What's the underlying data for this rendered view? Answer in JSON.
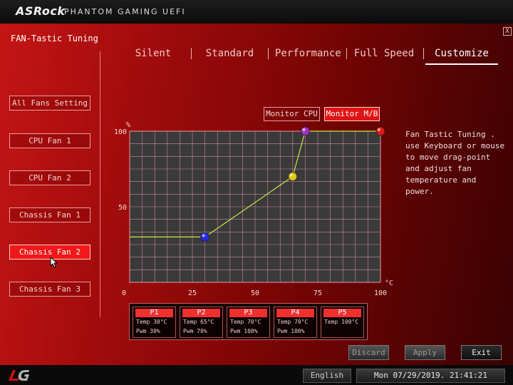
{
  "header": {
    "brand": "ASRock",
    "product": "PHANTOM GAMING UEFI"
  },
  "window": {
    "title": "FAN-Tastic Tuning",
    "close_label": "X"
  },
  "tabs": [
    {
      "label": "Silent",
      "active": false
    },
    {
      "label": "Standard",
      "active": false
    },
    {
      "label": "Performance",
      "active": false
    },
    {
      "label": "Full Speed",
      "active": false
    },
    {
      "label": "Customize",
      "active": true
    }
  ],
  "sidebar": {
    "items": [
      {
        "label": "All Fans Setting",
        "active": false
      },
      {
        "label": "CPU Fan 1",
        "active": false
      },
      {
        "label": "CPU Fan 2",
        "active": false
      },
      {
        "label": "Chassis Fan 1",
        "active": false
      },
      {
        "label": "Chassis Fan 2",
        "active": true
      },
      {
        "label": "Chassis Fan 3",
        "active": false
      }
    ]
  },
  "monitor": {
    "cpu_label": "Monitor CPU",
    "mb_label": "Monitor M/B",
    "selected": "Monitor M/B"
  },
  "help_text": "Fan Tastic Tuning . use Keyboard or mouse to move drag-point and adjust fan temperature and power.",
  "chart_data": {
    "type": "line",
    "xlabel": "°C",
    "ylabel": "%",
    "xlim": [
      0,
      100
    ],
    "ylim": [
      0,
      100
    ],
    "x_ticks": [
      "0",
      "25",
      "50",
      "75",
      "100"
    ],
    "y_ticks": [
      "50",
      "100"
    ],
    "grid": true,
    "series": [
      {
        "points": [
          {
            "x": 0,
            "y": 30
          },
          {
            "x": 30,
            "y": 30
          },
          {
            "x": 65,
            "y": 70
          },
          {
            "x": 70,
            "y": 100
          },
          {
            "x": 100,
            "y": 100
          }
        ]
      }
    ],
    "control_points": [
      {
        "x": 30,
        "y": 30,
        "color": "#2a2ae8"
      },
      {
        "x": 65,
        "y": 70,
        "color": "#e0c818"
      },
      {
        "x": 70,
        "y": 100,
        "color": "#a030c8"
      },
      {
        "x": 100,
        "y": 100,
        "color": "#e01818"
      }
    ],
    "colors": {
      "line": "#c8e848",
      "grid": "#e89aa8",
      "plot_bg": "#3a3a3a"
    }
  },
  "points": [
    {
      "name": "P1",
      "temp": "Temp 30°C",
      "pwm": "Pwm  30%"
    },
    {
      "name": "P2",
      "temp": "Temp 65°C",
      "pwm": "Pwm  70%"
    },
    {
      "name": "P3",
      "temp": "Temp 70°C",
      "pwm": "Pwm  100%"
    },
    {
      "name": "P4",
      "temp": "Temp 70°C",
      "pwm": "Pwm  100%"
    },
    {
      "name": "P5",
      "temp": "Temp 100°C",
      "pwm": ""
    }
  ],
  "actions": {
    "discard": "Discard",
    "apply": "Apply",
    "exit": "Exit"
  },
  "status": {
    "language": "English",
    "datetime": "Mon 07/29/2019. 21:41:21"
  }
}
